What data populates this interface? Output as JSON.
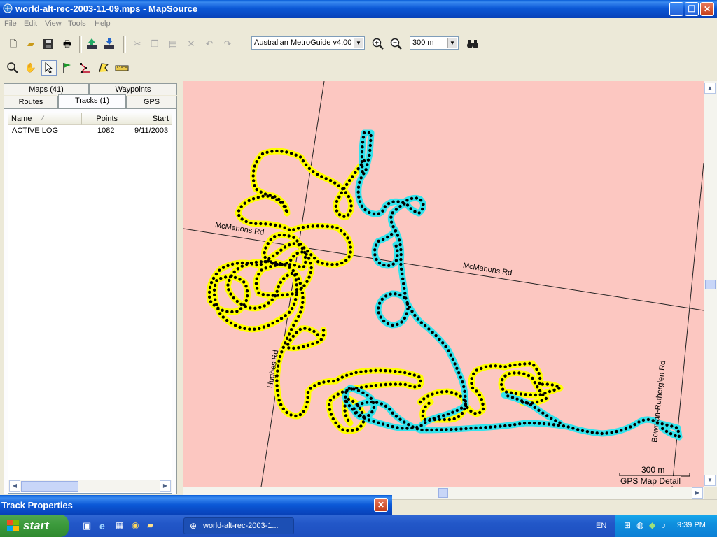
{
  "window": {
    "title": "world-alt-rec-2003-11-09.mps - MapSource",
    "minimize": "_",
    "maximize": "❐",
    "close": "✕"
  },
  "menu": [
    "File",
    "Edit",
    "View",
    "Tools",
    "Help"
  ],
  "toolbar": {
    "map_product": "Australian MetroGuide v4.00",
    "zoom_level": "300 m"
  },
  "tabs": {
    "row1": [
      "Maps (41)",
      "Waypoints"
    ],
    "row2": [
      "Routes",
      "Tracks (1)",
      "GPS"
    ],
    "active": "Tracks (1)"
  },
  "track_list": {
    "columns": [
      "Name",
      "Points",
      "Start"
    ],
    "rows": [
      {
        "name": "ACTIVE LOG",
        "points": "1082",
        "start": "9/11/2003"
      }
    ]
  },
  "map": {
    "roads": {
      "mcmahons_1": "McMahons Rd",
      "mcmahons_2": "McMahons Rd",
      "hughes": "Hughes Rd",
      "bowman": "Bowman-Rutherglen Rd"
    },
    "scale_label": "300 m",
    "detail_label": "GPS Map Detail",
    "background_color": "#fcc7c1",
    "track_colors": {
      "yellow": "#ffff00",
      "cyan": "#33e3ec",
      "points": "#000000"
    }
  },
  "dialog": {
    "title": "Track Properties"
  },
  "taskbar": {
    "start_label": "start",
    "task_label": "world-alt-rec-2003-1...",
    "language": "EN",
    "clock": "9:39 PM"
  }
}
